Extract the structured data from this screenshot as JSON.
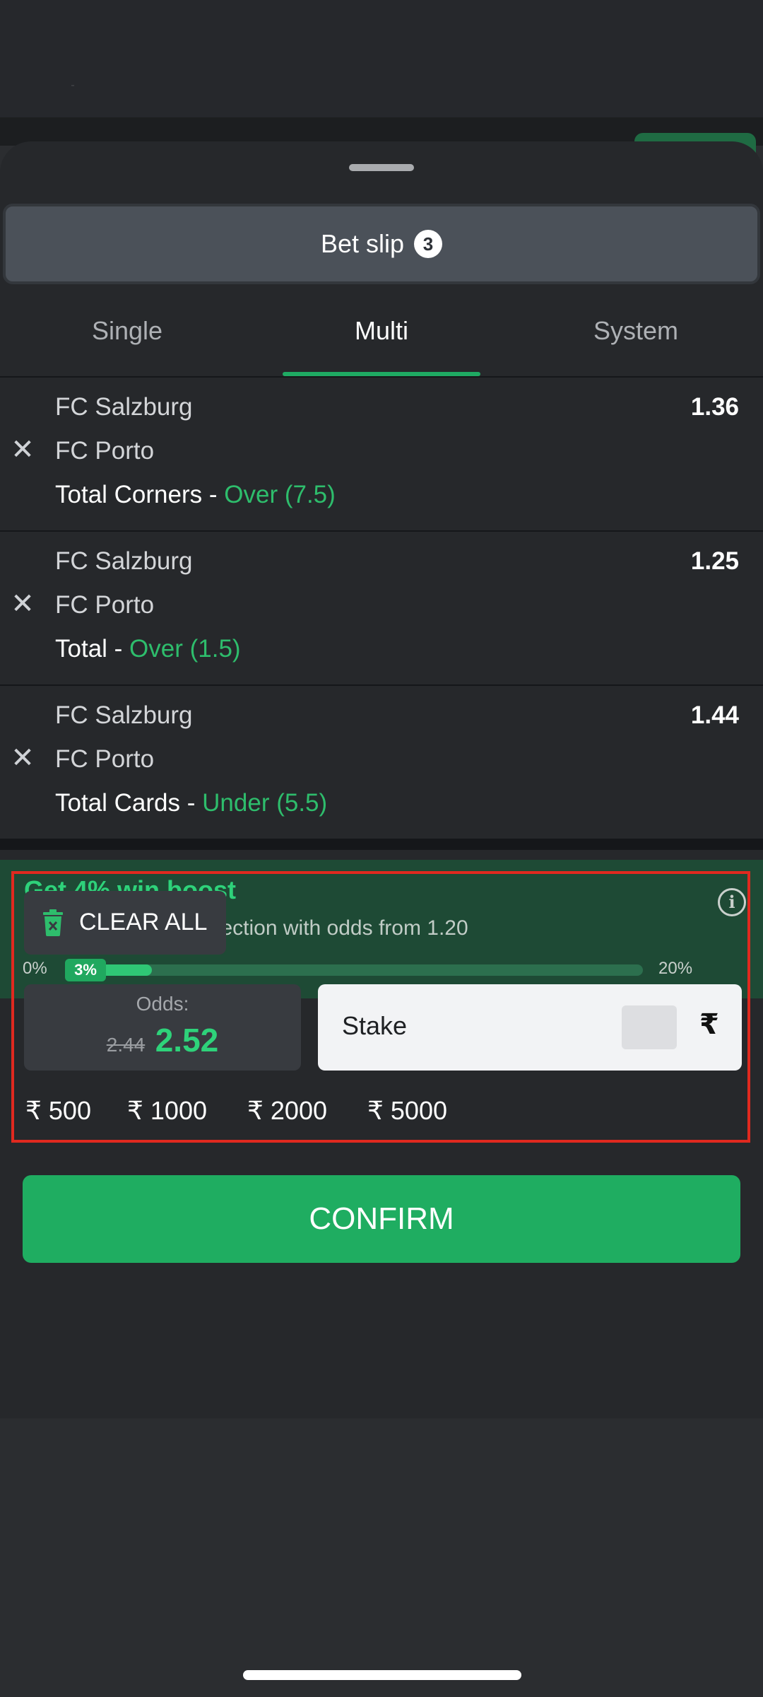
{
  "header": {
    "title": "Bet slip",
    "count": "3"
  },
  "tabs": [
    {
      "label": "Single",
      "active": false
    },
    {
      "label": "Multi",
      "active": true
    },
    {
      "label": "System",
      "active": false
    }
  ],
  "selections": [
    {
      "home": "FC Salzburg",
      "away": "FC Porto",
      "market": "Total Corners",
      "separator": " - ",
      "outcome": "Over (7.5)",
      "odds": "1.36"
    },
    {
      "home": "FC Salzburg",
      "away": "FC Porto",
      "market": "Total",
      "separator": " - ",
      "outcome": "Over (1.5)",
      "odds": "1.25"
    },
    {
      "home": "FC Salzburg",
      "away": "FC Porto",
      "market": "Total Cards",
      "separator": " - ",
      "outcome": "Under (5.5)",
      "odds": "1.44"
    }
  ],
  "boost": {
    "title": "Get 4% win boost",
    "subtitle": "if you add 1 more selection with odds from 1.20",
    "min_label": "0%",
    "max_label": "20%",
    "current_label": "3%",
    "progress_fraction": 0.15
  },
  "stake_panel": {
    "clear_label": "CLEAR ALL",
    "odds_label": "Odds:",
    "odds_old": "2.44",
    "odds_new": "2.52",
    "stake_label": "Stake",
    "currency": "₹",
    "quick_amounts": [
      "₹ 500",
      "₹ 1000",
      "₹ 2000",
      "₹ 5000"
    ]
  },
  "confirm_label": "CONFIRM",
  "colors": {
    "accent_green": "#2ebd6c",
    "button_green": "#1fad61",
    "highlight_red": "#e0291f"
  }
}
